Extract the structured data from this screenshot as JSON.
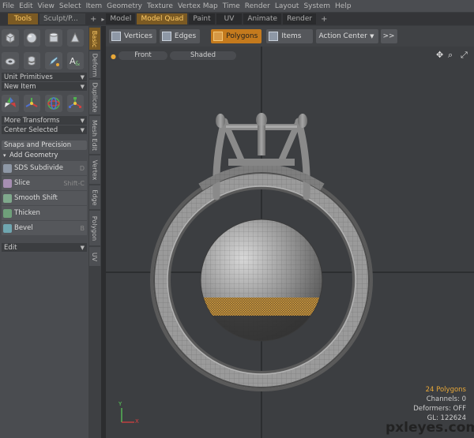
{
  "menu": {
    "items": [
      "File",
      "Edit",
      "View",
      "Select",
      "Item",
      "Geometry",
      "Texture",
      "Vertex Map",
      "Time",
      "Render",
      "Layout",
      "System",
      "Help"
    ]
  },
  "tabs": {
    "left": [
      {
        "label": "Tools"
      },
      {
        "label": "Sculpt/P..."
      }
    ],
    "main": [
      {
        "label": "Model"
      },
      {
        "label": "Model Quad"
      },
      {
        "label": "Paint"
      },
      {
        "label": "UV"
      },
      {
        "label": "Animate"
      },
      {
        "label": "Render"
      }
    ]
  },
  "leftpanel": {
    "dropdown1": "Unit Primitives",
    "dropdown2": "New Item",
    "dropdown3": "More Transforms",
    "dropdown4": "Center Selected",
    "snaps": "Snaps and Precision",
    "add_geometry": "Add Geometry",
    "tools": [
      {
        "label": "SDS Subdivide",
        "shortcut": "D",
        "color": "#8e98a6"
      },
      {
        "label": "Slice",
        "shortcut": "Shift-C",
        "color": "#a68eb2"
      },
      {
        "label": "Smooth Shift",
        "shortcut": "",
        "color": "#7fa88c"
      },
      {
        "label": "Thicken",
        "shortcut": "",
        "color": "#6fa07a"
      },
      {
        "label": "Bevel",
        "shortcut": "B",
        "color": "#6fa6b0"
      }
    ],
    "edit": "Edit"
  },
  "vtabs": [
    "Basic",
    "Deform",
    "Duplicate",
    "Mesh Edit",
    "Vertex",
    "Edge",
    "Polygon",
    "UV"
  ],
  "toolbar": {
    "vertices": "Vertices",
    "edges": "Edges",
    "polygons": "Polygons",
    "items": "Items",
    "action_center": "Action Center",
    "more": ">>"
  },
  "viewport": {
    "view": "Front",
    "shading": "Shaded",
    "stats": {
      "polygons": "24 Polygons",
      "channels": "Channels: 0",
      "deformers": "Deformers: OFF",
      "gl": "GL: 122624"
    },
    "axis_y": "Y",
    "axis_x": "X"
  },
  "watermark": "pxleyes.com",
  "colors": {
    "accent": "#c47a1d",
    "selection": "#e8a838",
    "bg": "#3c3e41"
  }
}
